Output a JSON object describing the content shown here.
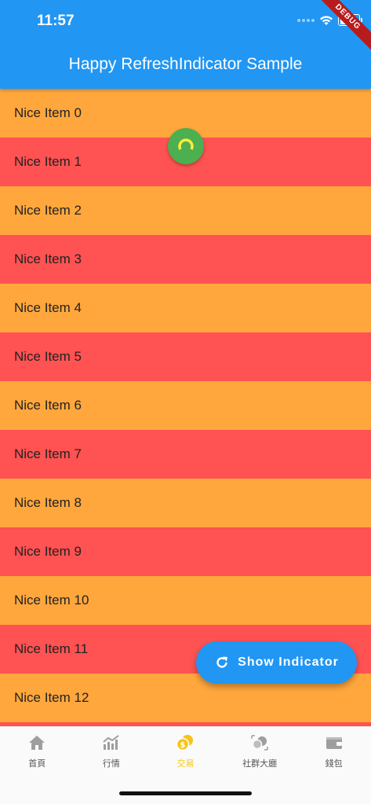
{
  "status_bar": {
    "time": "11:57"
  },
  "app_bar": {
    "title": "Happy RefreshIndicator Sample"
  },
  "debug_banner": "DEBUG",
  "list": {
    "items": [
      {
        "label": "Nice Item 0",
        "color": "#FFA73D"
      },
      {
        "label": "Nice Item 1",
        "color": "#FF5252"
      },
      {
        "label": "Nice Item 2",
        "color": "#FFA73D"
      },
      {
        "label": "Nice Item 3",
        "color": "#FF5252"
      },
      {
        "label": "Nice Item 4",
        "color": "#FFA73D"
      },
      {
        "label": "Nice Item 5",
        "color": "#FF5252"
      },
      {
        "label": "Nice Item 6",
        "color": "#FFA73D"
      },
      {
        "label": "Nice Item 7",
        "color": "#FF5252"
      },
      {
        "label": "Nice Item 8",
        "color": "#FFA73D"
      },
      {
        "label": "Nice Item 9",
        "color": "#FF5252"
      },
      {
        "label": "Nice Item 10",
        "color": "#FFA73D"
      },
      {
        "label": "Nice Item 11",
        "color": "#FF5252"
      },
      {
        "label": "Nice Item 12",
        "color": "#FFA73D"
      },
      {
        "label": "",
        "color": "#FF5252"
      }
    ]
  },
  "fab": {
    "label": "Show Indicator",
    "icon": "refresh-icon"
  },
  "bottom_nav": {
    "items": [
      {
        "label": "首頁",
        "icon": "home-icon"
      },
      {
        "label": "行情",
        "icon": "chart-icon"
      },
      {
        "label": "交易",
        "icon": "coin-icon",
        "active": true
      },
      {
        "label": "社群大廳",
        "icon": "community-icon"
      },
      {
        "label": "錢包",
        "icon": "wallet-icon"
      }
    ]
  },
  "colors": {
    "app_bar": "#2196F3",
    "item_orange": "#FFA73D",
    "item_red": "#FF5252",
    "indicator": "#4CAF50",
    "nav_active": "#F5C518"
  }
}
